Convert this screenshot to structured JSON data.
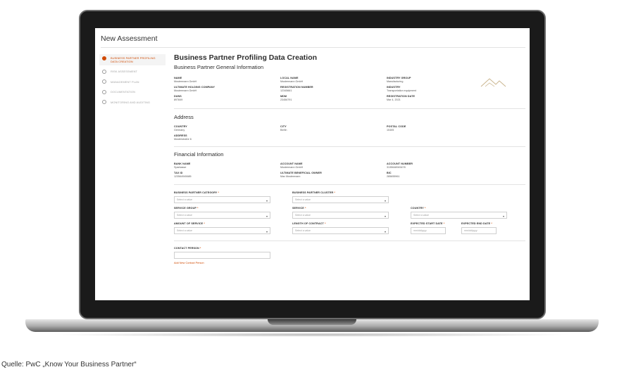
{
  "app": {
    "title": "New Assessment"
  },
  "sidebar": {
    "steps": [
      {
        "label": "Business Partner Profiling Data Creation",
        "active": true
      },
      {
        "label": "Risk Assessment",
        "active": false
      },
      {
        "label": "Management Plan",
        "active": false
      },
      {
        "label": "Documentation",
        "active": false
      },
      {
        "label": "Monitoring and Auditing",
        "active": false
      }
    ]
  },
  "main": {
    "heading": "Business Partner Profiling Data Creation",
    "general": {
      "title": "Business Partner General Information",
      "fields": [
        {
          "label": "Name",
          "value": "Mustermann GmbH"
        },
        {
          "label": "Local Name",
          "value": "Mustermann GmbH"
        },
        {
          "label": "Industry Group",
          "value": "Manufacturing"
        },
        {
          "label": "Ultimate Holding Company",
          "value": "Mustermann GmbH"
        },
        {
          "label": "Registration Number",
          "value": "12345661"
        },
        {
          "label": "Industry",
          "value": "Transportation equipment"
        },
        {
          "label": "DUNS",
          "value": "897849"
        },
        {
          "label": "MDM",
          "value": "23456791"
        },
        {
          "label": "Registration Date",
          "value": "Mar 4, 2021"
        }
      ]
    },
    "address": {
      "title": "Address",
      "fields": [
        {
          "label": "Country",
          "value": "Germany"
        },
        {
          "label": "City",
          "value": "Berlin"
        },
        {
          "label": "Postal Code",
          "value": "10405"
        },
        {
          "label": "Address",
          "value": "Musterstraße 6"
        }
      ]
    },
    "financial": {
      "title": "Financial Information",
      "fields": [
        {
          "label": "Bank Name",
          "value": "Sparkasse"
        },
        {
          "label": "Account Name",
          "value": "Mustermann GmbH"
        },
        {
          "label": "Account Number",
          "value": "3135648945478"
        },
        {
          "label": "Tax ID",
          "value": "123564945685"
        },
        {
          "label": "Ultimate Beneficial Owner",
          "value": "Max Mustermann"
        },
        {
          "label": "BIC",
          "value": "285655961"
        }
      ]
    },
    "form": {
      "bp_category": {
        "label": "Business Partner Category",
        "placeholder": "Select a value"
      },
      "bp_cluster": {
        "label": "Business Partner Cluster",
        "placeholder": "Select a value"
      },
      "service_group": {
        "label": "Service Group",
        "placeholder": "Select a value"
      },
      "service": {
        "label": "Service",
        "placeholder": "Select a value"
      },
      "country": {
        "label": "Country",
        "placeholder": "Select a value"
      },
      "amount": {
        "label": "Amount of Service",
        "placeholder": "Select a value"
      },
      "length": {
        "label": "Length of Contract",
        "placeholder": "Select a value"
      },
      "start_date": {
        "label": "Expected Start Date",
        "placeholder": "mm/dd/yyyy"
      },
      "end_date": {
        "label": "Expected End Date",
        "placeholder": "mm/dd/yyyy"
      },
      "contact": {
        "label": "Contact Person"
      },
      "required_mark": "*",
      "add_contact": "Add New Contact Person"
    }
  },
  "caption": "Quelle: PwC „Know Your Business Partner“",
  "colors": {
    "accent": "#d04a02",
    "logo": "#c8b28a"
  }
}
